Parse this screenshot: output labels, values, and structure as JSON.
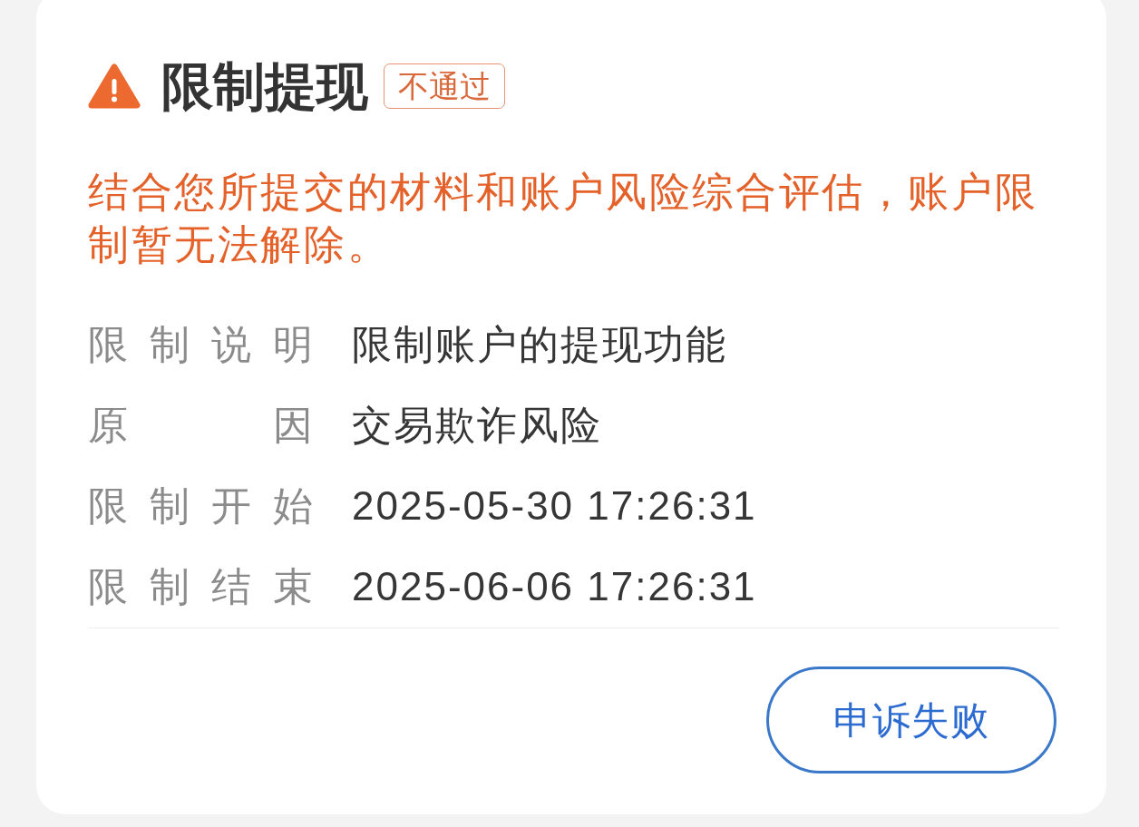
{
  "card": {
    "title": "限制提现",
    "status_badge": "不通过",
    "message": "结合您所提交的材料和账户风险综合评估，账户限制暂无法解除。",
    "details": [
      {
        "label": "限制说明",
        "value": "限制账户的提现功能"
      },
      {
        "label": "原因",
        "value": "交易欺诈风险"
      },
      {
        "label": "限制开始",
        "value": "2025-05-30 17:26:31"
      },
      {
        "label": "限制结束",
        "value": "2025-06-06 17:26:31"
      }
    ],
    "button": {
      "label": "申诉失败"
    }
  }
}
